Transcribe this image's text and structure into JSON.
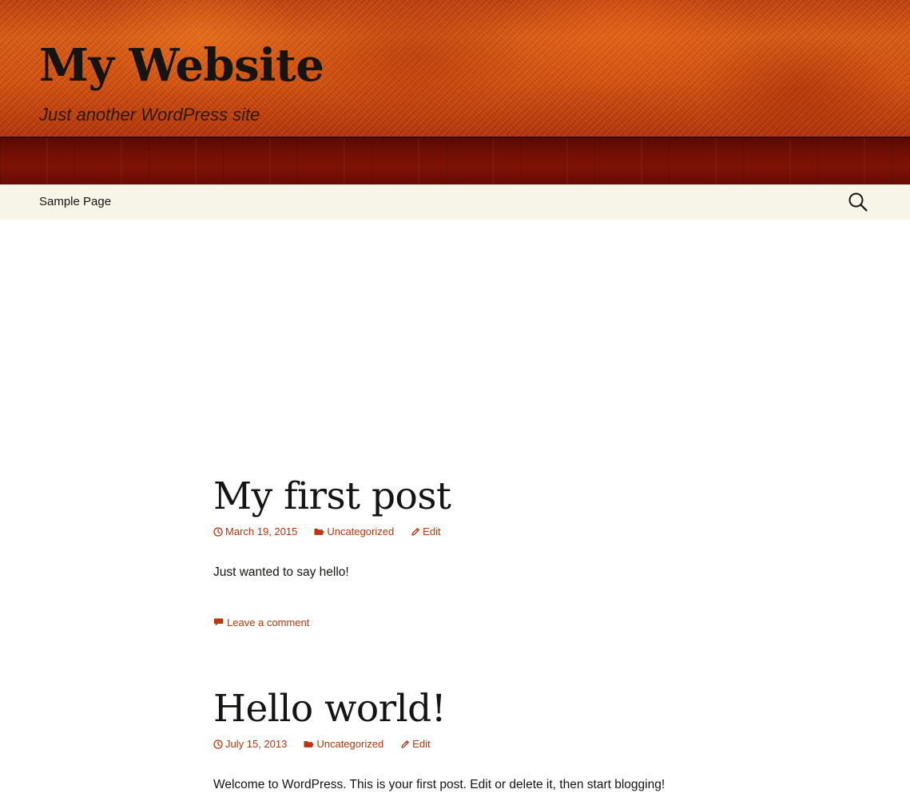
{
  "site": {
    "title": "My Website",
    "description": "Just another WordPress site"
  },
  "nav": {
    "items": [
      {
        "label": "Sample Page"
      }
    ],
    "search_icon": "search-icon"
  },
  "posts": [
    {
      "title": "My first post",
      "date": "March 19, 2015",
      "category": "Uncategorized",
      "edit_label": "Edit",
      "excerpt": "Just wanted to say hello!",
      "comment_label": "Leave a comment"
    },
    {
      "title": "Hello world!",
      "date": "July 15, 2013",
      "category": "Uncategorized",
      "edit_label": "Edit",
      "excerpt": "Welcome to WordPress. This is your first post. Edit or delete it, then start blogging!"
    }
  ],
  "colors": {
    "accent": "#bc360a",
    "nav_background": "#f7f5e7",
    "text": "#141412",
    "header_orange": "#d4500f",
    "header_band": "#740f05"
  }
}
